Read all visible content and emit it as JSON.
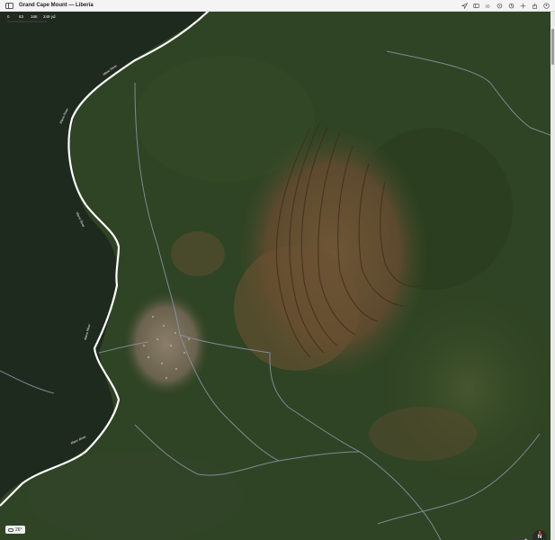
{
  "window": {
    "title": "Grand Cape Mount — Liberia"
  },
  "toolbar": {
    "icons": [
      "location-arrow-icon",
      "map-view-icon",
      "3d-view-icon",
      "look-around-icon",
      "tracking-icon",
      "add-icon",
      "share-icon",
      "account-icon"
    ]
  },
  "scale": {
    "ticks": [
      "0",
      "83",
      "166",
      "249 yd"
    ]
  },
  "map": {
    "river_labels": [
      "Mano River",
      "Mano River",
      "Mano River",
      "Mano River",
      "Mano River"
    ]
  },
  "weather": {
    "icon": "cloud-icon",
    "temperature": "26°"
  },
  "controls": {
    "zoom_out": "—",
    "zoom_in": "+",
    "compass": "N"
  },
  "colors": {
    "forest": "#2f4424",
    "cleared_land": "#6a5232",
    "river": "#1f2a1e",
    "border_line": "#ffffff",
    "road": "#8a96a8"
  }
}
